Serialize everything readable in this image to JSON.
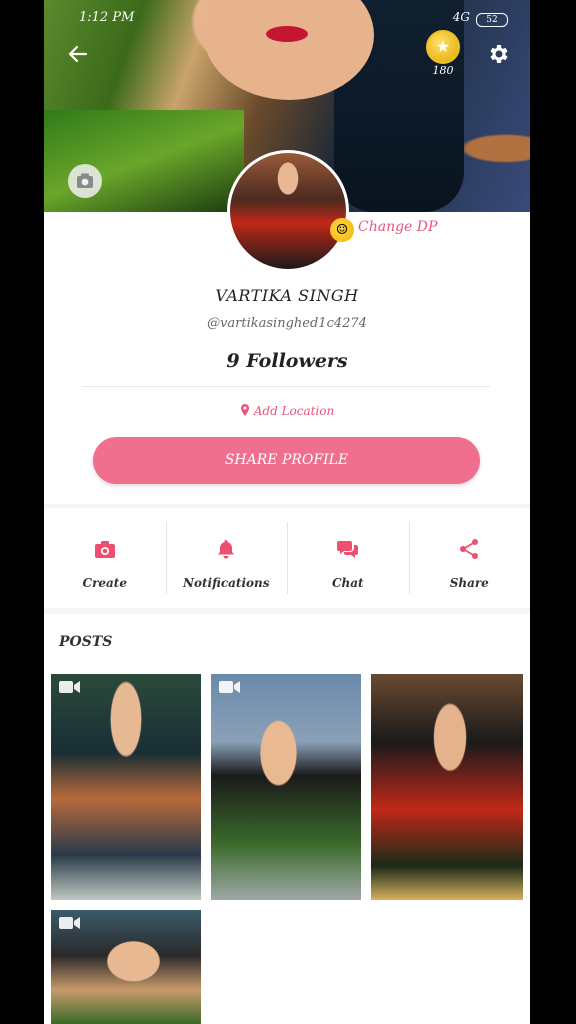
{
  "status_bar": {
    "time": "1:12 PM",
    "network": "4G",
    "battery": "52"
  },
  "header": {
    "coin_count": "180"
  },
  "profile": {
    "change_dp_label": "Change DP",
    "name": "VARTIKA SINGH",
    "handle": "@vartikasinghed1c4274",
    "followers": "9 Followers",
    "location_label": "Add Location",
    "share_profile_label": "SHARE PROFILE"
  },
  "actions": [
    {
      "label": "Create",
      "icon": "camera-icon"
    },
    {
      "label": "Notifications",
      "icon": "bell-icon"
    },
    {
      "label": "Chat",
      "icon": "chat-icon"
    },
    {
      "label": "Share",
      "icon": "share-icon"
    }
  ],
  "posts": {
    "title": "POSTS"
  },
  "colors": {
    "accent": "#f06e8e",
    "accent_text": "#e8557b"
  }
}
